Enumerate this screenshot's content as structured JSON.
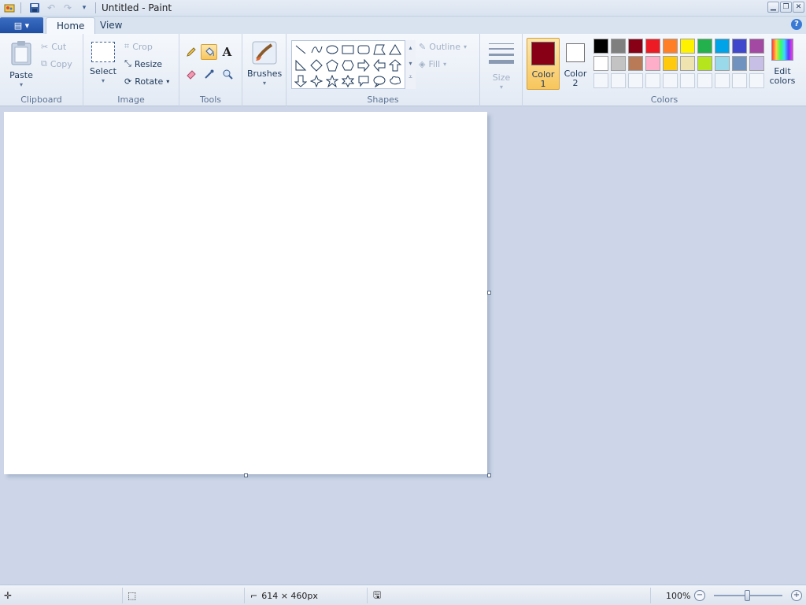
{
  "titlebar": {
    "title": "Untitled - Paint"
  },
  "tabs": {
    "home": "Home",
    "view": "View"
  },
  "clipboard": {
    "group_label": "Clipboard",
    "paste": "Paste",
    "cut": "Cut",
    "copy": "Copy"
  },
  "image": {
    "group_label": "Image",
    "select": "Select",
    "crop": "Crop",
    "resize": "Resize",
    "rotate": "Rotate"
  },
  "tools": {
    "group_label": "Tools",
    "active_tool": "fill-with-color"
  },
  "brushes": {
    "label": "Brushes"
  },
  "shapes": {
    "group_label": "Shapes",
    "outline": "Outline",
    "fill": "Fill",
    "size": "Size"
  },
  "colors": {
    "group_label": "Colors",
    "color1_line1": "Color",
    "color1_line2": "1",
    "color2_line1": "Color",
    "color2_line2": "2",
    "edit_line1": "Edit",
    "edit_line2": "colors",
    "color1_value": "#880015",
    "color2_value": "#ffffff",
    "palette_row1": [
      "#000000",
      "#7f7f7f",
      "#880015",
      "#ed1c24",
      "#ff7f27",
      "#fff200",
      "#22b14c",
      "#00a2e8",
      "#3f48cc",
      "#a349a4"
    ],
    "palette_row2": [
      "#ffffff",
      "#c3c3c3",
      "#b97a57",
      "#ffaec9",
      "#ffc90e",
      "#efe4b0",
      "#b5e61d",
      "#99d9ea",
      "#7092be",
      "#c8bfe7"
    ]
  },
  "statusbar": {
    "image_size": "614 × 460px",
    "zoom": "100%"
  }
}
